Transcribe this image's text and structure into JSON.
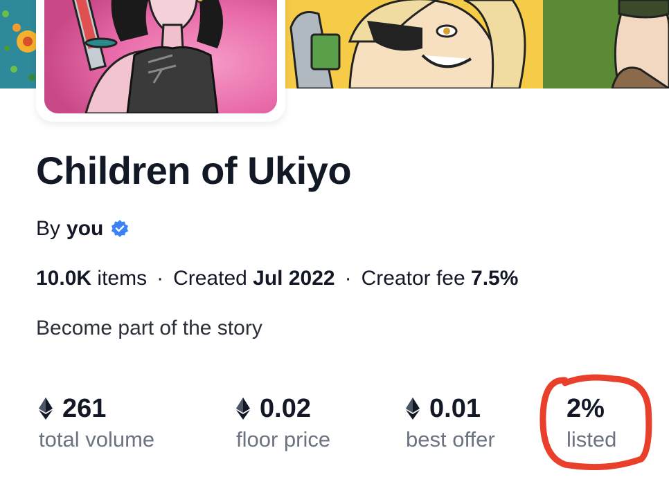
{
  "collection": {
    "title": "Children of Ukiyo",
    "by_prefix": "By",
    "creator": "you",
    "description": "Become part of the story"
  },
  "meta": {
    "items_value": "10.0K",
    "items_label": "items",
    "separator": "·",
    "created_label": "Created",
    "created_value": "Jul 2022",
    "fee_label": "Creator fee",
    "fee_value": "7.5%"
  },
  "stats": [
    {
      "value": "261",
      "label": "total volume",
      "icon": "ethereum-icon"
    },
    {
      "value": "0.02",
      "label": "floor price",
      "icon": "ethereum-icon"
    },
    {
      "value": "0.01",
      "label": "best offer",
      "icon": "ethereum-icon"
    },
    {
      "value": "2%",
      "label": "listed"
    }
  ],
  "colors": {
    "verified_badge": "#3b82f6",
    "highlight_circle": "#e8402a",
    "label_gray": "#6b7280",
    "text_dark": "#121826"
  }
}
